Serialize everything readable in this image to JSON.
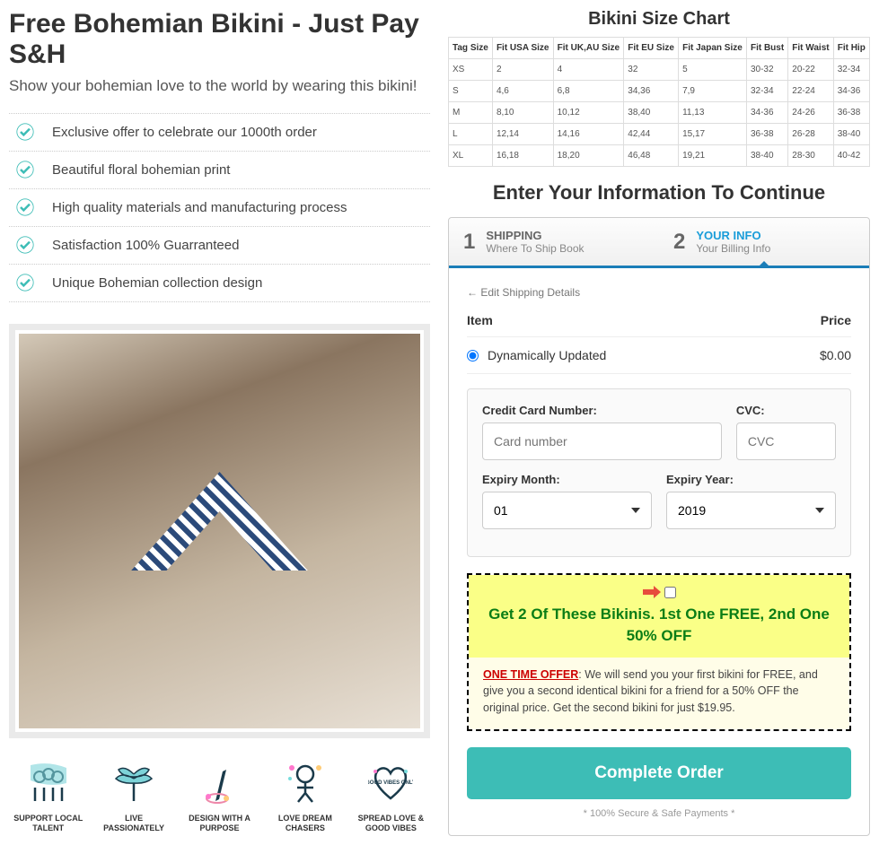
{
  "header": {
    "title": "Free Bohemian Bikini - Just Pay S&H",
    "subtitle": "Show your bohemian love to the world by wearing this bikini!"
  },
  "features": [
    "Exclusive offer to celebrate our 1000th order",
    "Beautiful floral bohemian print",
    "High quality materials and manufacturing process",
    "Satisfaction 100% Guarranteed",
    "Unique Bohemian collection design"
  ],
  "value_icons": [
    {
      "label": "SUPPORT LOCAL TALENT"
    },
    {
      "label": "LIVE PASSIONATELY"
    },
    {
      "label": "DESIGN WITH A PURPOSE"
    },
    {
      "label": "LOVE DREAM CHASERS"
    },
    {
      "label": "SPREAD LOVE & GOOD VIBES"
    }
  ],
  "size_chart": {
    "title": "Bikini Size Chart",
    "headers": [
      "Tag Size",
      "Fit USA Size",
      "Fit UK,AU Size",
      "Fit EU Size",
      "Fit Japan Size",
      "Fit Bust",
      "Fit Waist",
      "Fit Hip"
    ],
    "rows": [
      [
        "XS",
        "2",
        "4",
        "32",
        "5",
        "30-32",
        "20-22",
        "32-34"
      ],
      [
        "S",
        "4,6",
        "6,8",
        "34,36",
        "7,9",
        "32-34",
        "22-24",
        "34-36"
      ],
      [
        "M",
        "8,10",
        "10,12",
        "38,40",
        "11,13",
        "34-36",
        "24-26",
        "36-38"
      ],
      [
        "L",
        "12,14",
        "14,16",
        "42,44",
        "15,17",
        "36-38",
        "26-28",
        "38-40"
      ],
      [
        "XL",
        "16,18",
        "18,20",
        "46,48",
        "19,21",
        "38-40",
        "28-30",
        "40-42"
      ]
    ]
  },
  "form": {
    "title": "Enter Your Information To Continue",
    "steps": [
      {
        "num": "1",
        "title": "SHIPPING",
        "sub": "Where To Ship Book"
      },
      {
        "num": "2",
        "title": "YOUR INFO",
        "sub": "Your Billing Info"
      }
    ],
    "edit_link": "Edit Shipping Details",
    "item_header": {
      "item": "Item",
      "price": "Price"
    },
    "item_line": {
      "name": "Dynamically Updated",
      "price": "$0.00"
    },
    "cc": {
      "number_label": "Credit Card Number:",
      "number_placeholder": "Card number",
      "cvc_label": "CVC:",
      "cvc_placeholder": "CVC",
      "month_label": "Expiry Month:",
      "month_value": "01",
      "year_label": "Expiry Year:",
      "year_value": "2019"
    },
    "offer": {
      "title": "Get 2 Of These Bikinis. 1st One FREE, 2nd One 50% OFF",
      "red_label": "ONE TIME OFFER",
      "desc": ": We will send you your first bikini for FREE, and give you a second identical bikini for a friend for a 50% OFF the original price. Get the second bikini for just $19.95."
    },
    "button": "Complete Order",
    "secure": "* 100% Secure & Safe Payments *"
  }
}
